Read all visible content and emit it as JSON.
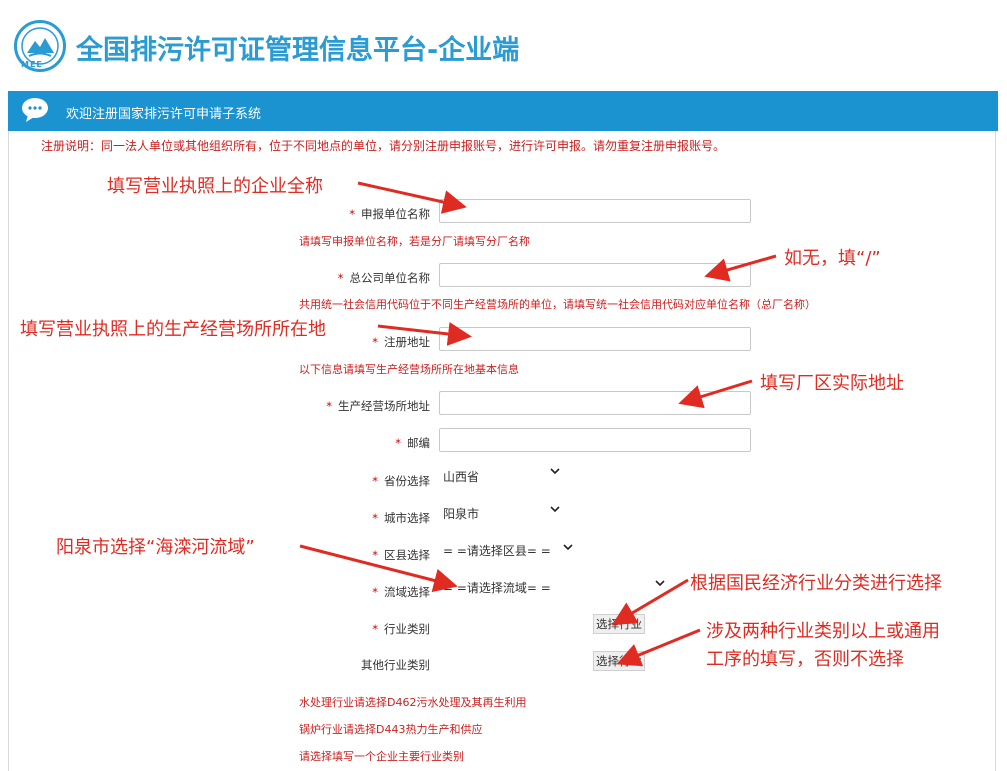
{
  "header": {
    "title": "全国排污许可证管理信息平台-企业端",
    "logo_text": "MEE"
  },
  "banner": {
    "title": "欢迎注册国家排污许可申请子系统"
  },
  "notice": "注册说明：同一法人单位或其他组织所有，位于不同地点的单位，请分别注册申报账号，进行许可申报。请勿重复注册申报账号。",
  "form": {
    "unit_name_label": "申报单位名称",
    "unit_name_hint": "请填写申报单位名称，若是分厂请填写分厂名称",
    "parent_name_label": "总公司单位名称",
    "parent_name_hint": "共用统一社会信用代码位于不同生产经营场所的单位，请填写统一社会信用代码对应单位名称（总厂名称）",
    "reg_address_label": "注册地址",
    "reg_address_hint": "以下信息请填写生产经营场所所在地基本信息",
    "site_address_label": "生产经营场所地址",
    "zip_label": "邮编",
    "province_label": "省份选择",
    "province_value": "山西省",
    "city_label": "城市选择",
    "city_value": "阳泉市",
    "county_label": "区县选择",
    "county_value": "= =请选择区县= =",
    "basin_label": "流域选择",
    "basin_value": "= =请选择流域= =",
    "industry_label": "行业类别",
    "industry_button": "选择行业",
    "other_industry_label": "其他行业类别",
    "other_industry_button": "选择行业",
    "notes": [
      "水处理行业请选择D462污水处理及其再生利用",
      "锅炉行业请选择D443热力生产和供应",
      "请选择填写一个企业主要行业类别"
    ],
    "required_mark": "*"
  },
  "annotations": {
    "a1": "填写营业执照上的企业全称",
    "a2": "如无，填“/”",
    "a3": "填写营业执照上的生产经营场所所在地",
    "a4": "填写厂区实际地址",
    "a5": "阳泉市选择“海滦河流域”",
    "a6": "根据国民经济行业分类进行选择",
    "a7_line1": "涉及两种行业类别以上或通用",
    "a7_line2": "工序的填写，否则不选择"
  },
  "colors": {
    "brand_blue": "#2a9bd3",
    "bar_blue": "#1c93d1",
    "annotation_red": "#e02b22",
    "hint_red": "#cc1f1f"
  },
  "icons": {
    "logo": "mee-logo-icon",
    "banner": "chat-bubble-icon",
    "dropdown": "chevron-down-icon"
  }
}
